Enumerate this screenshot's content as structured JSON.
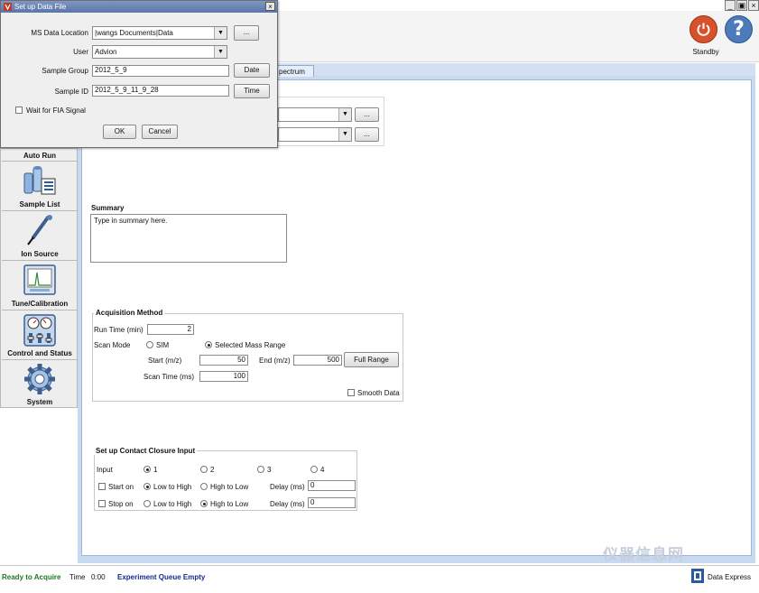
{
  "window_controls": [
    "_",
    "×"
  ],
  "toolbar": {
    "standby_label": "Standby",
    "help_label": "?"
  },
  "tabs": {
    "spectrum": "pectrum"
  },
  "sidebar": {
    "items": [
      {
        "label": "Auto Run",
        "icon": "auto-run-icon"
      },
      {
        "label": "Sample List",
        "icon": "sample-list-icon"
      },
      {
        "label": "Ion Source",
        "icon": "ion-source-icon"
      },
      {
        "label": "Tune/Calibration",
        "icon": "tune-calibration-icon"
      },
      {
        "label": "Control and Status",
        "icon": "control-status-icon"
      },
      {
        "label": "System",
        "icon": "system-gear-icon"
      }
    ]
  },
  "hidden_rows": {
    "browse1": "...",
    "browse2": "..."
  },
  "summary": {
    "label": "Summary",
    "text": "Type in summary here."
  },
  "acquisition": {
    "title": "Acquisition Method",
    "run_time_label": "Run Time (min)",
    "run_time_value": "2",
    "scan_mode_label": "Scan Mode",
    "sim_label": "SIM",
    "selected_mass_label": "Selected Mass Range",
    "start_label": "Start (m/z)",
    "start_value": "50",
    "end_label": "End (m/z)",
    "end_value": "500",
    "full_range_label": "Full Range",
    "scan_time_label": "Scan Time (ms)",
    "scan_time_value": "100",
    "smooth_label": "Smooth Data",
    "scan_mode_selected": "Selected Mass Range",
    "smooth_checked": false
  },
  "contact": {
    "title": "Set up Contact Closure Input",
    "input_label": "Input",
    "inputs": [
      "1",
      "2",
      "3",
      "4"
    ],
    "input_selected": "1",
    "start_on_label": "Start on",
    "stop_on_label": "Stop on",
    "low_high": "Low to High",
    "high_low": "High to Low",
    "delay_label": "Delay (ms)",
    "start_delay": "0",
    "stop_delay": "0",
    "start_edge": "Low to High",
    "stop_edge": "High to Low"
  },
  "dialog": {
    "title": "Set up Data File",
    "close": "×",
    "ms_location_label": "MS Data Location",
    "ms_location_value": "|wangs Documents|Data",
    "browse": "...",
    "user_label": "User",
    "user_value": "Advion",
    "sample_group_label": "Sample Group",
    "sample_group_value": "2012_5_9",
    "date_button": "Date",
    "sample_id_label": "Sample ID",
    "sample_id_value": "2012_5_9_11_9_28",
    "time_button": "Time",
    "fia_label": "Wait for FIA Signal",
    "ok": "OK",
    "cancel": "Cancel"
  },
  "status": {
    "ready": "Ready to Acquire",
    "time_label": "Time",
    "time_value": "0:00",
    "queue": "Experiment Queue Empty",
    "app_name": "Data Express"
  },
  "watermark": "仪器信息网",
  "colors": {
    "standby": "#d6512c",
    "help": "#4d7ab9",
    "ready_green": "#1f7a1f",
    "queue_blue": "#1a2a8a",
    "dialog_title": "#5a76aa"
  }
}
